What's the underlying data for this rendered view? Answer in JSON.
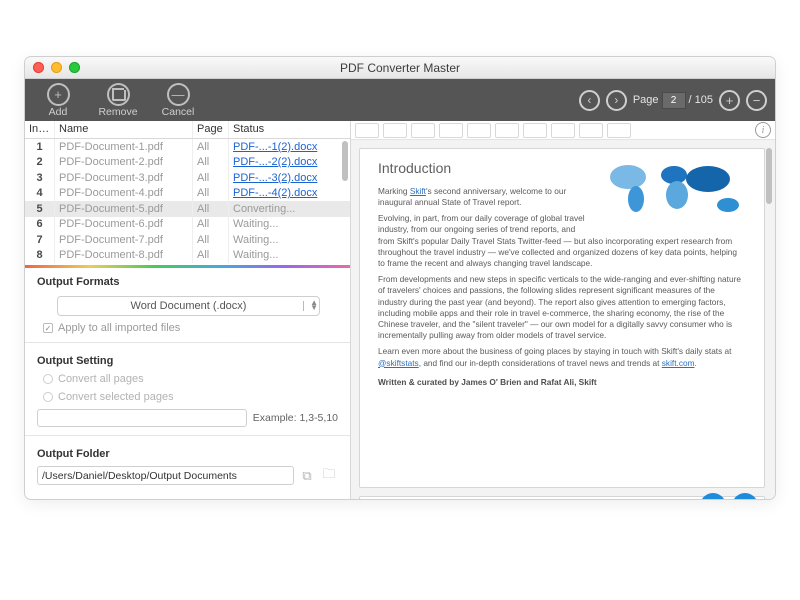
{
  "window": {
    "title": "PDF Converter Master"
  },
  "toolbar": {
    "add": "Add",
    "remove": "Remove",
    "cancel": "Cancel",
    "page_label": "Page",
    "current_page": "2",
    "total_pages": "/ 105"
  },
  "table": {
    "headers": {
      "index": "Index",
      "name": "Name",
      "page": "Page",
      "status": "Status"
    },
    "rows": [
      {
        "idx": "1",
        "name": "PDF-Document-1.pdf",
        "page": "All",
        "status": "PDF-...-1(2).docx",
        "link": true
      },
      {
        "idx": "2",
        "name": "PDF-Document-2.pdf",
        "page": "All",
        "status": "PDF-...-2(2).docx",
        "link": true
      },
      {
        "idx": "3",
        "name": "PDF-Document-3.pdf",
        "page": "All",
        "status": "PDF-...-3(2).docx",
        "link": true
      },
      {
        "idx": "4",
        "name": "PDF-Document-4.pdf",
        "page": "All",
        "status": "PDF-...-4(2).docx",
        "link": true
      },
      {
        "idx": "5",
        "name": "PDF-Document-5.pdf",
        "page": "All",
        "status": "Converting...",
        "link": false,
        "selected": true
      },
      {
        "idx": "6",
        "name": "PDF-Document-6.pdf",
        "page": "All",
        "status": "Waiting...",
        "link": false
      },
      {
        "idx": "7",
        "name": "PDF-Document-7.pdf",
        "page": "All",
        "status": "Waiting...",
        "link": false
      },
      {
        "idx": "8",
        "name": "PDF-Document-8.pdf",
        "page": "All",
        "status": "Waiting...",
        "link": false
      }
    ]
  },
  "settings": {
    "output_formats_title": "Output Formats",
    "format_value": "Word Document (.docx)",
    "apply_all": "Apply to all imported files",
    "output_setting_title": "Output Setting",
    "convert_all": "Convert all pages",
    "convert_selected": "Convert selected pages",
    "example_label": "Example: 1,3-5,10",
    "output_folder_title": "Output Folder",
    "output_folder_value": "/Users/Daniel/Desktop/Output Documents"
  },
  "preview": {
    "heading": "Introduction",
    "p1a": "Marking ",
    "p1_link1": "Skift",
    "p1b": "'s second anniversary, welcome to our inaugural annual State of Travel report.",
    "p2": "Evolving, in part, from our daily coverage of global travel industry, from our ongoing series of trend reports, and from Skift's popular Daily Travel Stats Twitter-feed — but also incorporating expert research from throughout the travel industry — we've collected and organized dozens of key data points, helping to frame the recent and always changing travel landscape.",
    "p3": "From developments and new steps in specific verticals to the wide-ranging and ever-shifting nature of travelers' choices and passions, the following slides represent significant measures of the industry during the past year (and beyond). The report also gives attention to emerging factors, including mobile apps and their role in travel e-commerce, the sharing economy, the rise of the Chinese traveler, and the \"silent traveler\" — our own model for a digitally savvy consumer who is incrementally pulling away from older models of travel service.",
    "p4a": "Learn even more about the business of going places by staying in touch with Skift's daily stats at ",
    "p4_link1": "@skiftstats",
    "p4b": ", and find our in-depth considerations of travel news and trends at ",
    "p4_link2": "skift.com",
    "p4c": ".",
    "byline": "Written & curated by James O' Brien and Rafat Ali, Skift"
  }
}
